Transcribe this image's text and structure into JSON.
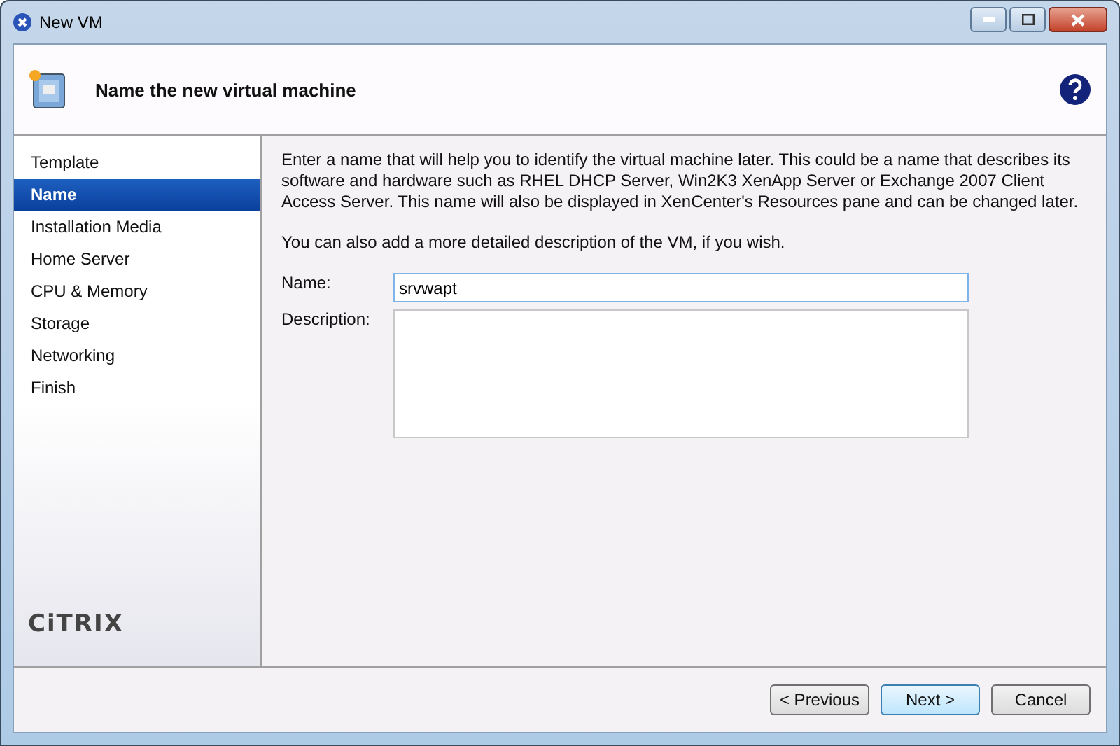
{
  "window": {
    "title": "New VM"
  },
  "header": {
    "title": "Name the new virtual machine"
  },
  "steps": [
    {
      "label": "Template",
      "selected": false
    },
    {
      "label": "Name",
      "selected": true
    },
    {
      "label": "Installation Media",
      "selected": false
    },
    {
      "label": "Home Server",
      "selected": false
    },
    {
      "label": "CPU & Memory",
      "selected": false
    },
    {
      "label": "Storage",
      "selected": false
    },
    {
      "label": "Networking",
      "selected": false
    },
    {
      "label": "Finish",
      "selected": false
    }
  ],
  "logo": "CiTRIX",
  "intro": "Enter a name that will help you to identify the virtual machine later. This could be a name that describes its software and hardware such as RHEL DHCP Server, Win2K3 XenApp Server or Exchange 2007 Client Access Server. This name will also be displayed in XenCenter's Resources pane and can be changed later.",
  "hint": "You can also add a more detailed description of the VM, if you wish.",
  "name_field": {
    "label": "Name:",
    "value": "srvwapt"
  },
  "description_field": {
    "label": "Description:"
  },
  "buttons": [
    {
      "label": "< Previous",
      "default": false
    },
    {
      "label": "Next >",
      "default": true
    },
    {
      "label": "Cancel",
      "default": false
    }
  ]
}
